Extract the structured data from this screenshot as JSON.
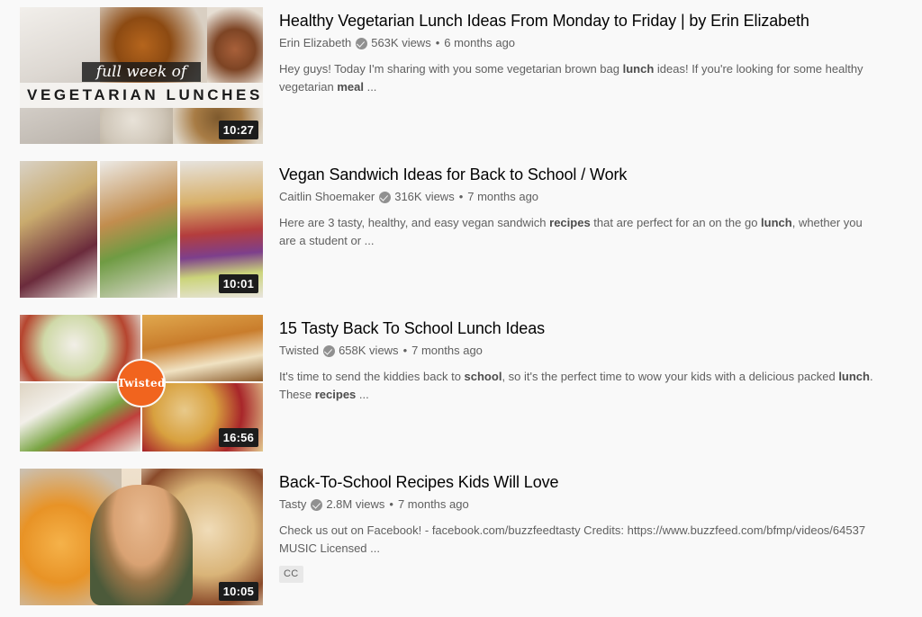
{
  "page": {
    "background_color": "#f9f9f9",
    "title_color": "#030303",
    "meta_color": "#606060",
    "accent_orange": "#f1641e"
  },
  "results": [
    {
      "title": "Healthy Vegetarian Lunch Ideas From Monday to Friday | by Erin Elizabeth",
      "channel": "Erin Elizabeth",
      "verified": true,
      "verified_icon": "verified-check-icon",
      "views": "563K views",
      "separator": "•",
      "published": "6 months ago",
      "description_parts": [
        {
          "text": "Hey guys! Today I'm sharing with you some vegetarian brown bag ",
          "bold": false
        },
        {
          "text": "lunch",
          "bold": true
        },
        {
          "text": " ideas! If you're looking for some healthy vegetarian ",
          "bold": false
        },
        {
          "text": "meal",
          "bold": true
        },
        {
          "text": " ...",
          "bold": false
        }
      ],
      "duration": "10:27",
      "badges": [],
      "thumbnail": {
        "style": "vegetarian-lunches-collage",
        "overlay_script_text": "full week of",
        "overlay_block_text": "VEGETARIAN LUNCHES"
      }
    },
    {
      "title": "Vegan Sandwich Ideas for Back to School / Work",
      "channel": "Caitlin Shoemaker",
      "verified": true,
      "verified_icon": "verified-check-icon",
      "views": "316K views",
      "separator": "•",
      "published": "7 months ago",
      "description_parts": [
        {
          "text": "Here are 3 tasty, healthy, and easy vegan sandwich ",
          "bold": false
        },
        {
          "text": "recipes",
          "bold": true
        },
        {
          "text": " that are perfect for an on the go ",
          "bold": false
        },
        {
          "text": "lunch",
          "bold": true
        },
        {
          "text": ", whether you are a student or ...",
          "bold": false
        }
      ],
      "duration": "10:01",
      "badges": [],
      "thumbnail": {
        "style": "three-sandwich-panels"
      }
    },
    {
      "title": "15 Tasty Back To School Lunch Ideas",
      "channel": "Twisted",
      "verified": true,
      "verified_icon": "verified-check-icon",
      "views": "658K views",
      "separator": "•",
      "published": "7 months ago",
      "description_parts": [
        {
          "text": "It's time to send the kiddies back to ",
          "bold": false
        },
        {
          "text": "school",
          "bold": true
        },
        {
          "text": ", so it's the perfect time to wow your kids with a delicious packed ",
          "bold": false
        },
        {
          "text": "lunch",
          "bold": true
        },
        {
          "text": ". These ",
          "bold": false
        },
        {
          "text": "recipes",
          "bold": true
        },
        {
          "text": " ...",
          "bold": false
        }
      ],
      "duration": "16:56",
      "badges": [],
      "thumbnail": {
        "style": "four-panel-food-grid",
        "logo_text": "Twisted"
      }
    },
    {
      "title": "Back-To-School Recipes Kids Will Love",
      "channel": "Tasty",
      "verified": true,
      "verified_icon": "verified-check-icon",
      "views": "2.8M views",
      "separator": "•",
      "published": "7 months ago",
      "description_parts": [
        {
          "text": "Check us out on Facebook! - facebook.com/buzzfeedtasty Credits: https://www.buzzfeed.com/bfmp/videos/64537 MUSIC Licensed ...",
          "bold": false
        }
      ],
      "duration": "10:05",
      "badges": [
        "CC"
      ],
      "thumbnail": {
        "style": "person-with-snacks"
      }
    }
  ]
}
